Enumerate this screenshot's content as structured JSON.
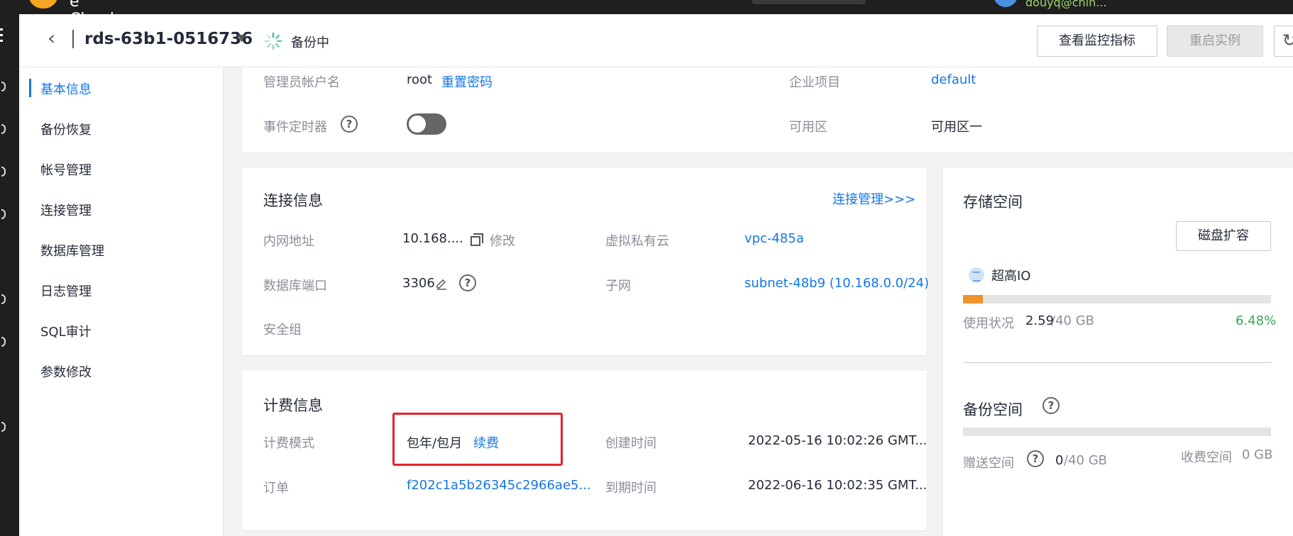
{
  "topbar": {
    "logo_text": "e Cloud",
    "user": "douyq@chin..."
  },
  "header": {
    "instance_name": "rds-63b1-0516736",
    "status": "备份中",
    "view_metrics_button": "查看监控指标",
    "restart_button": "重启实例"
  },
  "sidenav": {
    "items": [
      {
        "label": "基本信息",
        "active": true
      },
      {
        "label": "备份恢复"
      },
      {
        "label": "帐号管理"
      },
      {
        "label": "连接管理"
      },
      {
        "label": "数据库管理"
      },
      {
        "label": "日志管理"
      },
      {
        "label": "SQL审计"
      },
      {
        "label": "参数修改"
      }
    ]
  },
  "basic": {
    "admin_label": "管理员帐户名",
    "admin_value": "root",
    "reset_password": "重置密码",
    "event_timer_label": "事件定时器",
    "event_timer_on": false,
    "enterprise_label": "企业项目",
    "enterprise_value": "default",
    "az_label": "可用区",
    "az_value": "可用区一"
  },
  "connection": {
    "title": "连接信息",
    "manage_link": "连接管理>>>",
    "ip_label": "内网地址",
    "ip_value": "10.168....",
    "modify": "修改",
    "vpc_label": "虚拟私有云",
    "vpc_value": "vpc-485a",
    "port_label": "数据库端口",
    "port_value": "3306",
    "subnet_label": "子网",
    "subnet_value": "subnet-48b9 (10.168.0.0/24)",
    "sg_label": "安全组"
  },
  "billing": {
    "title": "计费信息",
    "mode_label": "计费模式",
    "mode_value": "包年/包月",
    "renew": "续费",
    "created_label": "创建时间",
    "created_value": "2022-05-16 10:02:26 GMT...",
    "order_label": "订单",
    "order_value": "f202c1a5b26345c2966ae5...",
    "expire_label": "到期时间",
    "expire_value": "2022-06-16 10:02:35 GMT..."
  },
  "storage": {
    "title": "存储空间",
    "expand_button": "磁盘扩容",
    "type": "超高IO",
    "usage_label": "使用状况",
    "used": "2.59",
    "total": "/40 GB",
    "percent": "6.48%",
    "percent_value": 0.0648,
    "backup_title": "备份空间",
    "free_label": "赠送空间",
    "free_used": "0",
    "free_total": "/40 GB",
    "paid_label": "收费空间",
    "paid_value": "0 GB"
  },
  "colors": {
    "accent": "#1476e8",
    "progress": "#f0932b",
    "percent": "#3aa65a",
    "highlight": "#e6222a"
  }
}
